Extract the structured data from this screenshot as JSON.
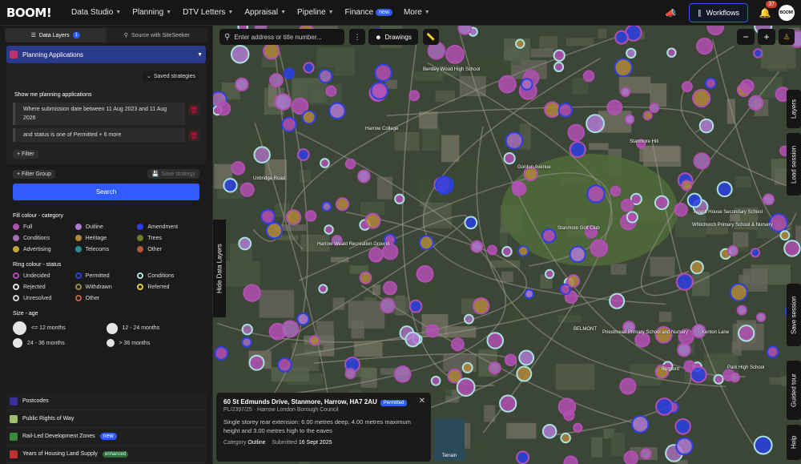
{
  "topbar": {
    "logo": "BOOM!",
    "nav": [
      {
        "label": "Data Studio",
        "has_chevron": true
      },
      {
        "label": "Planning",
        "has_chevron": true
      },
      {
        "label": "DTV Letters",
        "has_chevron": true
      },
      {
        "label": "Appraisal",
        "has_chevron": true
      },
      {
        "label": "Pipeline",
        "has_chevron": true
      },
      {
        "label": "Finance",
        "badge": "new",
        "has_chevron": false
      },
      {
        "label": "More",
        "has_chevron": true
      }
    ],
    "workflows_label": "Workflows",
    "notification_count": "37",
    "avatar_text": "BOOM!"
  },
  "sidebar": {
    "tab_data_layers": "Data Layers",
    "tab_data_layers_count": "1",
    "tab_site_seeker": "Source with SiteSeeker",
    "layer_title": "Planning Applications",
    "saved_strategies": "Saved strategies",
    "show_me": "Show me planning applications",
    "filter1": "Where submission date between 11 Aug 2023 and 11 Aug 2026",
    "filter2": "and status is one of Permitted + 6 more",
    "add_filter": "+ Filter",
    "add_filter_group": "+ Filter Group",
    "save_strategy": "Save strategy",
    "search_button": "Search",
    "fill_title": "Fill colour - category",
    "fill_items": [
      {
        "label": "Full",
        "color": "#b24fb3"
      },
      {
        "label": "Outline",
        "color": "#b07ad0"
      },
      {
        "label": "Amendment",
        "color": "#2c3fe0"
      },
      {
        "label": "Conditions",
        "color": "#a56fb8"
      },
      {
        "label": "Heritage",
        "color": "#b0883a"
      },
      {
        "label": "Trees",
        "color": "#6f7a2a"
      },
      {
        "label": "Advertising",
        "color": "#c2a43a"
      },
      {
        "label": "Telecoms",
        "color": "#2a8c8c"
      },
      {
        "label": "Other",
        "color": "#b2583a"
      }
    ],
    "ring_title": "Ring colour - status",
    "ring_items": [
      {
        "label": "Undecided",
        "color": "#b24fb3"
      },
      {
        "label": "Permitted",
        "color": "#2c3fe0"
      },
      {
        "label": "Conditions",
        "color": "#a8e0e0"
      },
      {
        "label": "Rejected",
        "color": "#e0e0e0"
      },
      {
        "label": "Withdrawn",
        "color": "#9a8a50"
      },
      {
        "label": "Referred",
        "color": "#e0c840"
      },
      {
        "label": "Unresolved",
        "color": "#d0d0d0"
      },
      {
        "label": "Other",
        "color": "#c06040"
      }
    ],
    "size_title": "Size - age",
    "size_items": [
      "<= 12 months",
      "12 - 24 months",
      "24 - 36 months",
      "> 36 months"
    ],
    "bottom_layers": [
      {
        "label": "Postcodes",
        "color": "#3b2f9e"
      },
      {
        "label": "Public Rights of Way",
        "color": "#9fc06a"
      },
      {
        "label": "Rail-Led Development Zones",
        "color": "#3a8a3a",
        "badge": "new"
      },
      {
        "label": "Years of Housing Land Supply",
        "color": "#c03030",
        "badge": "enhanced"
      }
    ]
  },
  "map": {
    "search_placeholder": "Enter address or title number...",
    "drawings_label": "Drawings",
    "hide_layers": "Hide Data Layers",
    "right_tabs": [
      "Layers",
      "Load session",
      "Save session",
      "Guided tour",
      "Help"
    ],
    "layers_count": "1",
    "labels": [
      "Bentley Wood High School",
      "Harrow College",
      "Stanmore Golf Club",
      "Harrow Weald Recreation Ground",
      "Avanti House Secondary School",
      "Whitchurch Primary School & Nursery",
      "Park High School",
      "Priestmead Primary School and Nursery",
      "BELMONT",
      "Stanmore Hill",
      "Belmont",
      "Uxbridge Road",
      "Gordon Avenue",
      "Kenton Lane"
    ],
    "terrain_label": "Terrain",
    "popup": {
      "address": "60 St Edmunds Drive, Stanmore, Harrow, HA7 2AU",
      "status": "Permitted",
      "ref": "PL/2397/25 · Harrow London Borough Council",
      "description": "Single storey rear extension: 6.00 metres deep, 4.00 metres maximum height and 3.00 metres high to the eaves",
      "category_label": "Category",
      "category_value": "Outline",
      "submitted_label": "Submitted",
      "submitted_value": "16 Sept 2025"
    }
  }
}
